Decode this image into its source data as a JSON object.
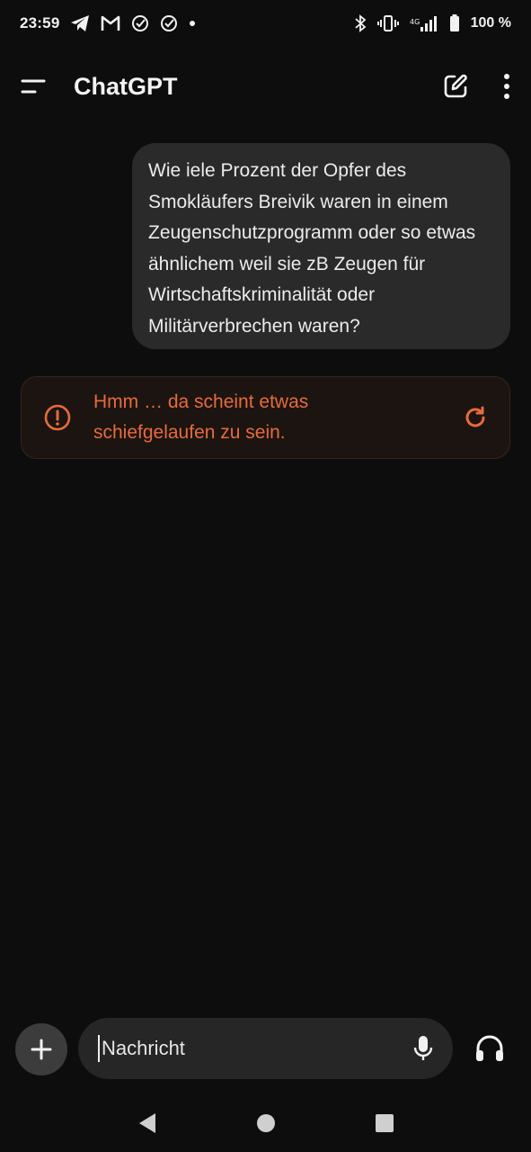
{
  "status_bar": {
    "time": "23:59",
    "battery": "100 %",
    "left_icons": [
      "telegram-icon",
      "gmail-icon",
      "check-circle-icon",
      "check-circle-icon",
      "dot-icon"
    ],
    "right_icons": [
      "bluetooth-icon",
      "vibrate-icon",
      "signal-icon",
      "battery-icon"
    ]
  },
  "app_bar": {
    "title": "ChatGPT",
    "menu_icon": "menu-icon",
    "new_chat_icon": "edit-icon",
    "more_icon": "more-vert-icon"
  },
  "conversation": {
    "user_message": "Wie iele Prozent der Opfer des Smokläufers Breivik waren in einem Zeugenschutzprogramm oder so etwas ähnlichem weil sie zB Zeugen für Wirtschaftskriminalität oder Militärverbrechen waren?",
    "error": {
      "text": "Hmm … da scheint etwas schiefgelaufen zu sein.",
      "icon": "alert-circle-icon",
      "retry_icon": "refresh-icon"
    }
  },
  "composer": {
    "placeholder": "Nachricht",
    "value": ""
  },
  "colors": {
    "background": "#0d0d0d",
    "bubble": "#2a2a2a",
    "error_accent": "#e86a3c"
  }
}
